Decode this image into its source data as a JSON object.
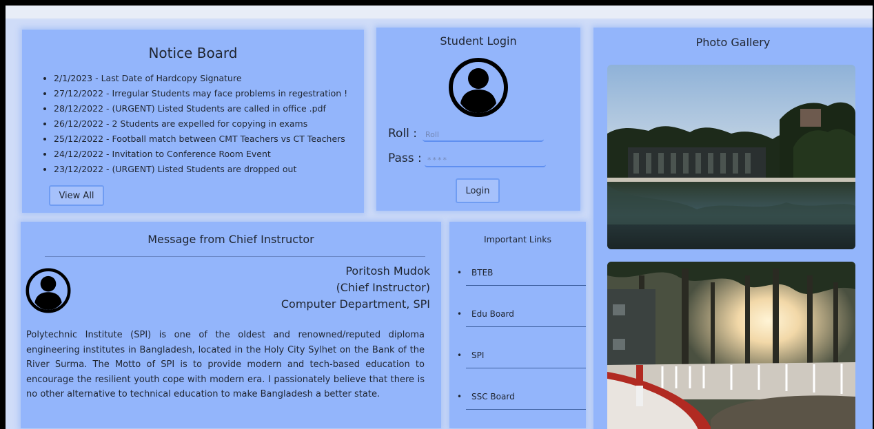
{
  "notice_board": {
    "title": "Notice Board",
    "items": [
      "2/1/2023 - Last Date of Hardcopy Signature",
      "27/12/2022 - Irregular Students may face problems in regestration !",
      "28/12/2022 - (URGENT) Listed Students are called in office .pdf",
      "26/12/2022 - 2 Students are expelled for copying in exams",
      "25/12/2022 - Football match between CMT Teachers vs CT Teachers",
      "24/12/2022 - Invitation to Conference Room Event",
      "23/12/2022 - (URGENT) Listed Students are dropped out"
    ],
    "view_all_label": "View All"
  },
  "login": {
    "title": "Student Login",
    "avatar_icon": "user-avatar-icon",
    "roll_label": "Roll :",
    "roll_placeholder": "Roll",
    "pass_label": "Pass :",
    "pass_placeholder": "****",
    "button_label": "Login"
  },
  "gallery": {
    "title": "Photo Gallery",
    "photos": [
      "lake-campus-photo",
      "sunset-trees-walkway-photo"
    ]
  },
  "message": {
    "title": "Message from Chief Instructor",
    "name": "Poritosh Mudok",
    "role": "(Chief Instructor)",
    "department": "Computer Department, SPI",
    "body": "Polytechnic Institute (SPI) is one of the oldest and renowned/reputed diploma engineering institutes in Bangladesh, located in the Holy City Sylhet on the Bank of the River Surma. The Motto of SPI is to provide modern and tech-based education to encourage the resilient youth cope with modern era. I passionately believe that there is no other alternative to technical education to make Bangladesh a better state."
  },
  "links": {
    "title": "Important Links",
    "items": [
      "BTEB",
      "Edu Board",
      "SPI",
      "SSC Board"
    ]
  },
  "colors": {
    "panel_bg": "#93b5fb",
    "page_bg": "#cfdcf8",
    "button_border": "#6f9cf2"
  }
}
